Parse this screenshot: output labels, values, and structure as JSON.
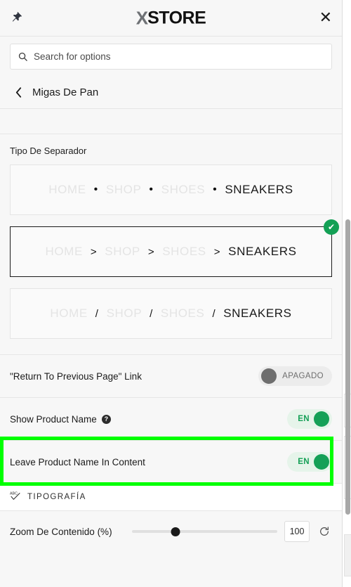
{
  "header": {
    "pin_icon": "pin-icon",
    "logo_mark": "X",
    "logo_text": "STORE",
    "close_icon": "✕"
  },
  "search": {
    "placeholder": "Search for options",
    "value": "",
    "icon": "search-icon"
  },
  "breadcrumb": {
    "back_icon": "‹",
    "title": "Migas De Pan"
  },
  "separator_field": {
    "label": "Tipo De Separador",
    "options": [
      {
        "separator": "•",
        "sep_kind": "dot",
        "items": [
          "HOME",
          "SHOP",
          "SHOES",
          "SNEAKERS"
        ],
        "selected": false
      },
      {
        "separator": ">",
        "sep_kind": "gt",
        "items": [
          "HOME",
          "SHOP",
          "SHOES",
          "SNEAKERS"
        ],
        "selected": true
      },
      {
        "separator": "/",
        "sep_kind": "slash",
        "items": [
          "HOME",
          "SHOP",
          "SHOES",
          "SNEAKERS"
        ],
        "selected": false
      }
    ],
    "selected_badge": "✔"
  },
  "rows": [
    {
      "label": "\"Return To Previous Page\" Link",
      "has_help": false,
      "toggle": {
        "state": "off",
        "text": "APAGADO"
      }
    },
    {
      "label": "Show Product Name",
      "has_help": true,
      "help_glyph": "?",
      "toggle": {
        "state": "on",
        "text": "EN"
      }
    },
    {
      "label": "Leave Product Name In Content",
      "has_help": false,
      "highlighted": true,
      "toggle": {
        "state": "on",
        "text": "EN"
      }
    }
  ],
  "typography": {
    "icon": "spellcheck-icon",
    "label": "TIPOGRAFÍA"
  },
  "zoom": {
    "label": "Zoom De Contenido (%)",
    "value": "100",
    "slider_percent": 30,
    "reset_icon": "reset-icon"
  },
  "colors": {
    "accent_green": "#15a057",
    "highlight_green": "#00ff00",
    "panel_bg": "#f7f7f7"
  }
}
